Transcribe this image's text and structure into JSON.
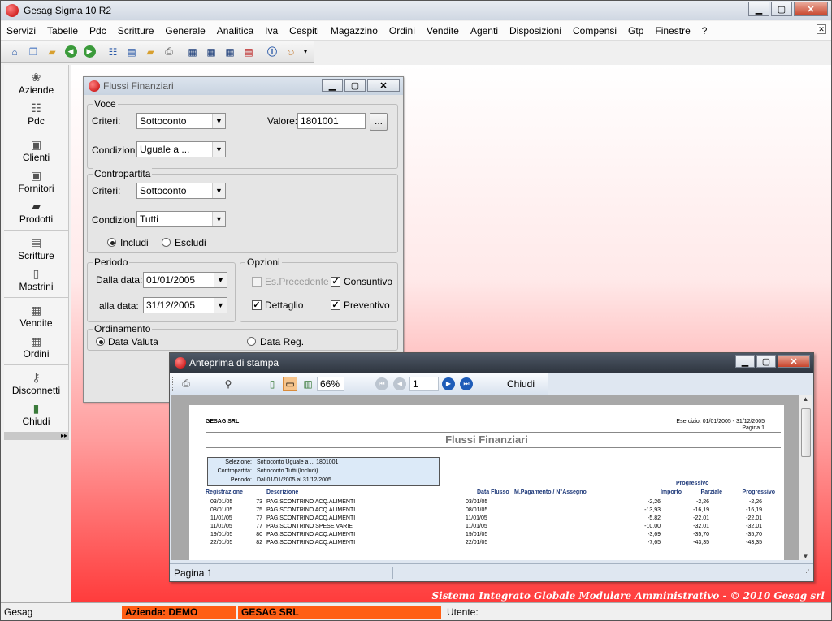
{
  "app": {
    "title": "Gesag Sigma 10 R2"
  },
  "menu": [
    "Servizi",
    "Tabelle",
    "Pdc",
    "Scritture",
    "Generale",
    "Analitica",
    "Iva",
    "Cespiti",
    "Magazzino",
    "Ordini",
    "Vendite",
    "Agenti",
    "Disposizioni",
    "Compensi",
    "Gtp",
    "Finestre",
    "?"
  ],
  "sidebar": [
    {
      "label": "Aziende",
      "icon": "companies-icon"
    },
    {
      "label": "Pdc",
      "icon": "chart-of-accounts-icon"
    },
    {
      "label": "Clienti",
      "icon": "clients-icon"
    },
    {
      "label": "Fornitori",
      "icon": "suppliers-icon"
    },
    {
      "label": "Prodotti",
      "icon": "products-icon"
    },
    {
      "label": "Scritture",
      "icon": "entries-icon"
    },
    {
      "label": "Mastrini",
      "icon": "ledgers-icon"
    },
    {
      "label": "Vendite",
      "icon": "sales-icon"
    },
    {
      "label": "Ordini",
      "icon": "orders-icon"
    },
    {
      "label": "Disconnetti",
      "icon": "disconnect-icon"
    },
    {
      "label": "Chiudi",
      "icon": "exit-icon"
    }
  ],
  "flussi": {
    "title": "Flussi Finanziari",
    "voce": {
      "legend": "Voce",
      "criteri_label": "Criteri:",
      "criteri_value": "Sottoconto",
      "valore_label": "Valore:",
      "valore_value": "1801001",
      "browse_label": "...",
      "condizioni_label": "Condizioni:",
      "condizioni_value": "Uguale a ..."
    },
    "contropartita": {
      "legend": "Contropartita",
      "criteri_label": "Criteri:",
      "criteri_value": "Sottoconto",
      "condizioni_label": "Condizioni:",
      "condizioni_value": "Tutti",
      "includi_label": "Includi",
      "escludi_label": "Escludi"
    },
    "periodo": {
      "legend": "Periodo",
      "dalla_label": "Dalla data:",
      "dalla_value": "01/01/2005",
      "alla_label": "alla data:",
      "alla_value": "31/12/2005"
    },
    "opzioni": {
      "legend": "Opzioni",
      "es_precedente": "Es.Precedente",
      "consuntivo": "Consuntivo",
      "dettaglio": "Dettaglio",
      "preventivo": "Preventivo"
    },
    "ordinamento": {
      "legend": "Ordinamento",
      "data_valuta": "Data Valuta",
      "data_reg": "Data Reg."
    }
  },
  "preview": {
    "title": "Anteprima di stampa",
    "zoom": "66%",
    "page": "1",
    "chiudi": "Chiudi",
    "status": "Pagina 1",
    "report": {
      "company": "GESAG SRL",
      "esercizio": "Esercizio: 01/01/2005 - 31/12/2005",
      "pagina": "Pagina 1",
      "title": "Flussi Finanziari",
      "selezione_label": "Selezione:",
      "selezione_value": "Sottoconto Uguale a ... 1801001",
      "contropartita_label": "Contropartita:",
      "contropartita_value": "Sottoconto Tutti  (Includi)",
      "periodo_label": "Periodo:",
      "periodo_value": "Dal 01/01/2005 al 31/12/2005",
      "col_progressivo_top": "Progressivo",
      "headers": [
        "Registrazione",
        "Descrizione",
        "Data Flusso",
        "M.Pagamento / N°Assegno",
        "Importo",
        "Parziale",
        "Progressivo"
      ],
      "rows": [
        [
          "03/01/05",
          "73",
          "PAG.SCONTRINO ACQ.ALIMENTI",
          "03/01/05",
          "-2,26",
          "-2,26",
          "-2,26"
        ],
        [
          "08/01/05",
          "75",
          "PAG.SCONTRINO ACQ.ALIMENTI",
          "08/01/05",
          "-13,93",
          "-16,19",
          "-16,19"
        ],
        [
          "11/01/05",
          "77",
          "PAG.SCONTRINO ACQ.ALIMENTI",
          "11/01/05",
          "-5,82",
          "-22,01",
          "-22,01"
        ],
        [
          "11/01/05",
          "77",
          "PAG.SCONTRINO SPESE VARIE",
          "11/01/05",
          "-10,00",
          "-32,01",
          "-32,01"
        ],
        [
          "19/01/05",
          "80",
          "PAG.SCONTRINO ACQ.ALIMENTI",
          "19/01/05",
          "-3,69",
          "-35,70",
          "-35,70"
        ],
        [
          "22/01/05",
          "82",
          "PAG.SCONTRINO ACQ.ALIMENTI",
          "22/01/05",
          "-7,65",
          "-43,35",
          "-43,35"
        ]
      ]
    }
  },
  "footer": "Sistema Integrato Globale Modulare Amministrativo - © 2010 Gesag srl",
  "status": {
    "app": "Gesag",
    "azienda": "Azienda: DEMO",
    "company": "GESAG SRL",
    "utente": "Utente:"
  }
}
